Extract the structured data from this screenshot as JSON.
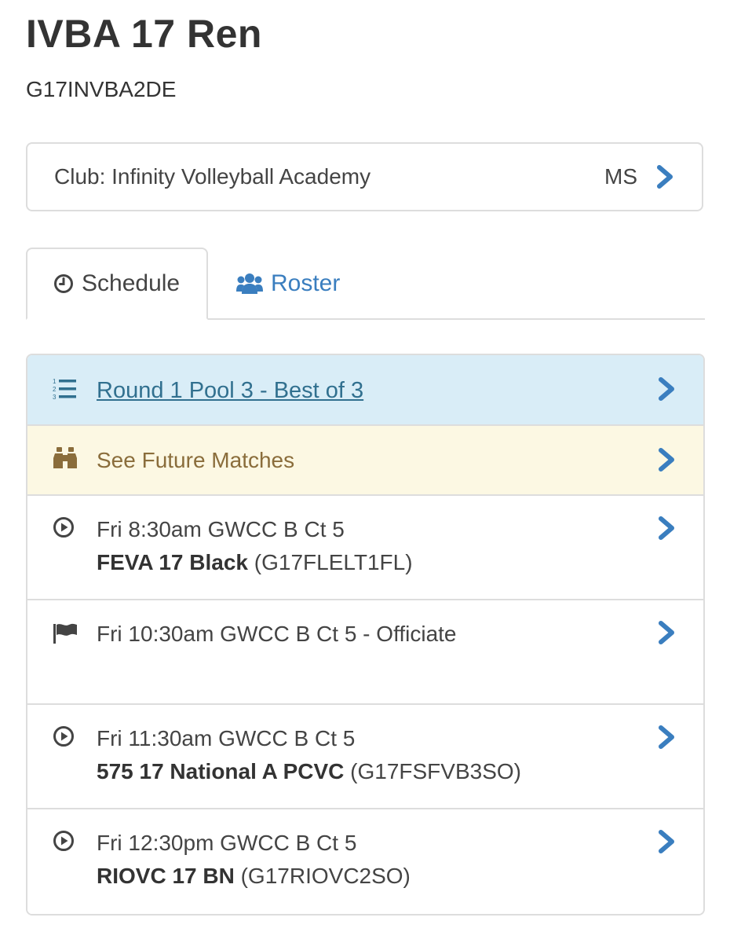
{
  "team": {
    "title": "IVBA 17 Ren",
    "code": "G17INVBA2DE"
  },
  "club": {
    "label": "Club: Infinity Volleyball Academy",
    "state": "MS"
  },
  "tabs": [
    {
      "label": "Schedule",
      "icon": "clock-icon",
      "active": true
    },
    {
      "label": "Roster",
      "icon": "users-icon",
      "active": false
    }
  ],
  "schedule": {
    "round": {
      "label": "Round 1 Pool 3 - Best of 3",
      "icon": "ordered-list-icon"
    },
    "future": {
      "label": "See Future Matches",
      "icon": "binoculars-icon"
    },
    "matches": [
      {
        "icon": "play-circle-icon",
        "time_court": "Fri 8:30am GWCC B Ct 5",
        "opponent": "FEVA 17 Black",
        "opponent_code": "(G17FLELT1FL)"
      },
      {
        "icon": "flag-icon",
        "time_court": "Fri 10:30am GWCC B Ct 5 - Officiate",
        "opponent": "",
        "opponent_code": ""
      },
      {
        "icon": "play-circle-icon",
        "time_court": "Fri 11:30am GWCC B Ct 5",
        "opponent": "575 17 National A PCVC",
        "opponent_code": "(G17FSFVB3SO)"
      },
      {
        "icon": "play-circle-icon",
        "time_court": "Fri 12:30pm GWCC B Ct 5",
        "opponent": "RIOVC 17 BN",
        "opponent_code": "(G17RIOVC2SO)"
      }
    ]
  },
  "colors": {
    "link_blue": "#3a7ebf",
    "round_bg": "#d9edf7",
    "round_text": "#31708f",
    "future_bg": "#fcf8e3",
    "future_text": "#8a6d3b",
    "border": "#dddddd"
  }
}
